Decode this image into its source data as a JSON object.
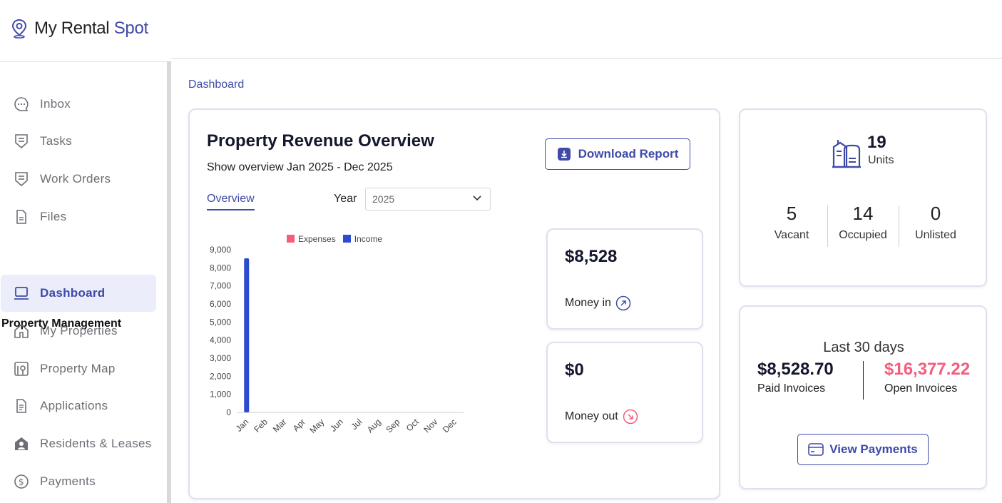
{
  "app": {
    "brand_part1": "My Rental",
    "brand_part2": "Spot",
    "accent": "#3f4aa8"
  },
  "sidebar": {
    "items": [
      {
        "label": "Inbox",
        "icon": "chat-bubble-icon"
      },
      {
        "label": "Tasks",
        "icon": "task-list-icon"
      },
      {
        "label": "Work Orders",
        "icon": "clipboard-icon"
      },
      {
        "label": "Files",
        "icon": "file-icon"
      }
    ],
    "section_label": "Property Management",
    "pm_items": [
      {
        "label": "Dashboard",
        "icon": "laptop-icon",
        "active": true
      },
      {
        "label": "My Properties",
        "icon": "home-icon"
      },
      {
        "label": "Property Map",
        "icon": "map-icon"
      },
      {
        "label": "Applications",
        "icon": "document-icon"
      },
      {
        "label": "Residents & Leases",
        "icon": "person-house-icon"
      },
      {
        "label": "Payments",
        "icon": "dollar-coin-icon"
      }
    ]
  },
  "breadcrumb": "Dashboard",
  "revenue": {
    "title": "Property Revenue Overview",
    "subtitle": "Show overview Jan 2025 - Dec 2025",
    "download_label": "Download Report",
    "tab_overview": "Overview",
    "year_label": "Year",
    "year_value": "2025"
  },
  "chart_data": {
    "type": "bar",
    "categories": [
      "Jan",
      "Feb",
      "Mar",
      "Apr",
      "May",
      "Jun",
      "Jul",
      "Aug",
      "Sep",
      "Oct",
      "Nov",
      "Dec"
    ],
    "series": [
      {
        "name": "Expenses",
        "color": "#f45d7c",
        "values": [
          0,
          0,
          0,
          0,
          0,
          0,
          0,
          0,
          0,
          0,
          0,
          0
        ]
      },
      {
        "name": "Income",
        "color": "#2d4bd1",
        "values": [
          8528,
          0,
          0,
          0,
          0,
          0,
          0,
          0,
          0,
          0,
          0,
          0
        ]
      }
    ],
    "ylim": [
      0,
      9000
    ],
    "yticks": [
      "0",
      "1,000",
      "2,000",
      "3,000",
      "4,000",
      "5,000",
      "6,000",
      "7,000",
      "8,000",
      "9,000"
    ],
    "legend": "top",
    "grid": false
  },
  "money_in": {
    "amount": "$8,528",
    "label": "Money in",
    "icon": "arrow-up-right-icon"
  },
  "money_out": {
    "amount": "$0",
    "label": "Money out",
    "icon": "arrow-down-right-icon",
    "color": "#f45d7c"
  },
  "units": {
    "count": "19",
    "label": "Units",
    "icon": "buildings-icon",
    "stats": [
      {
        "value": "5",
        "label": "Vacant"
      },
      {
        "value": "14",
        "label": "Occupied"
      },
      {
        "value": "0",
        "label": "Unlisted"
      }
    ]
  },
  "payments": {
    "title": "Last 30 days",
    "paid_value": "$8,528.70",
    "paid_label": "Paid Invoices",
    "open_value": "$16,377.22",
    "open_label": "Open Invoices",
    "open_color": "#f45d7c",
    "button_label": "View Payments",
    "button_icon": "credit-card-icon"
  }
}
